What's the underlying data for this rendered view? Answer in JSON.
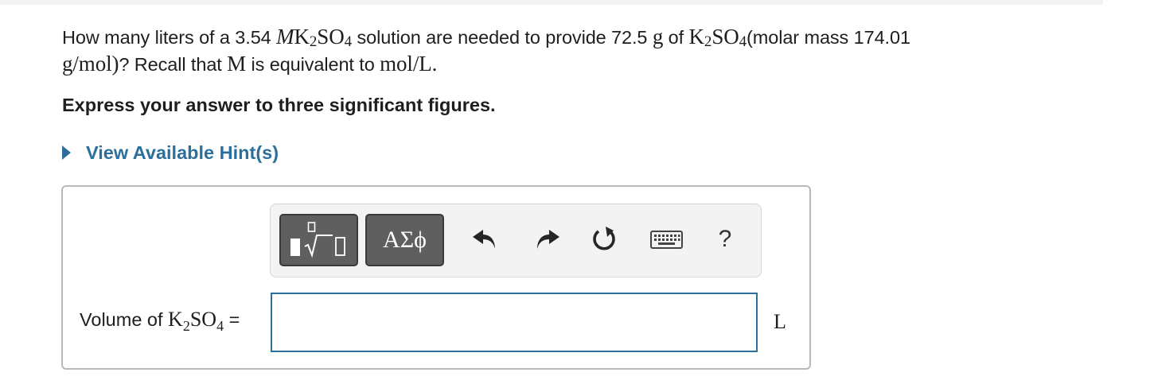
{
  "question": {
    "t1": "How many liters of a 3.54 ",
    "m_italic": "M",
    "k": "K",
    "sub2": "2",
    "so": "SO",
    "sub4": "4",
    "t2": " solution are needed to provide 72.5 ",
    "g": "g",
    "t3": " of ",
    "t4": "(molar mass 174.01",
    "gmol": "g/mol)",
    "t5": "? Recall that ",
    "m_upright": "M",
    "t6": " is equivalent to ",
    "moll": "mol/L",
    "t7": "."
  },
  "instruction": "Express your answer to three significant figures.",
  "hint": {
    "label": "View Available Hint(s)"
  },
  "toolbar": {
    "symbols_label": "ΑΣϕ",
    "help_label": "?",
    "icons": [
      "templates-icon",
      "undo-icon",
      "redo-icon",
      "reset-icon",
      "keyboard-icon",
      "help-icon"
    ]
  },
  "answer": {
    "label_prefix": "Volume of ",
    "k": "K",
    "sub2": "2",
    "so": "SO",
    "sub4": "4",
    "equals": " =",
    "value": "",
    "unit": "L"
  },
  "colors": {
    "accent": "#2b6f9c",
    "button_dark": "#5f5f5f",
    "border": "#b9b9b9"
  }
}
